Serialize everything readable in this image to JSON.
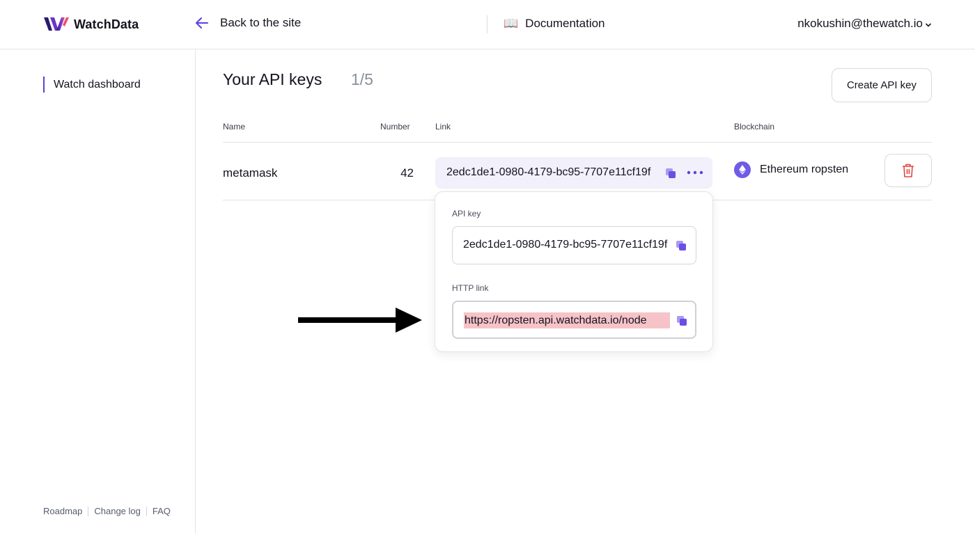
{
  "header": {
    "logo_text": "WatchData",
    "back_label": "Back to the site",
    "docs_label": "Documentation",
    "user_email": "nkokushin@thewatch.io"
  },
  "sidebar": {
    "items": [
      {
        "label": "Watch dashboard"
      }
    ],
    "footer_links": [
      "Roadmap",
      "Change log",
      "FAQ"
    ]
  },
  "main": {
    "title": "Your API keys",
    "count": "1/5",
    "create_button": "Create API key",
    "columns": [
      "Name",
      "Number",
      "Link",
      "Blockchain"
    ],
    "rows": [
      {
        "name": "metamask",
        "number": "42",
        "link": "2edc1de1-0980-4179-bc95-7707e11cf19f",
        "blockchain": "Ethereum ropsten"
      }
    ]
  },
  "popup": {
    "api_key_label": "API key",
    "api_key_value": "2edc1de1-0980-4179-bc95-7707e11cf19f",
    "http_link_label": "HTTP link",
    "http_link_value": "https://ropsten.api.watchdata.io/node"
  },
  "colors": {
    "accent": "#5b3fe0",
    "link_bg": "#f1f0fb",
    "highlight": "#f6c3c8",
    "delete": "#e0453c"
  },
  "icons": [
    "back-arrow-icon",
    "book-icon",
    "chevron-down-icon",
    "copy-icon",
    "more-dots-icon",
    "ethereum-icon",
    "trash-icon",
    "pointer-arrow-icon"
  ]
}
